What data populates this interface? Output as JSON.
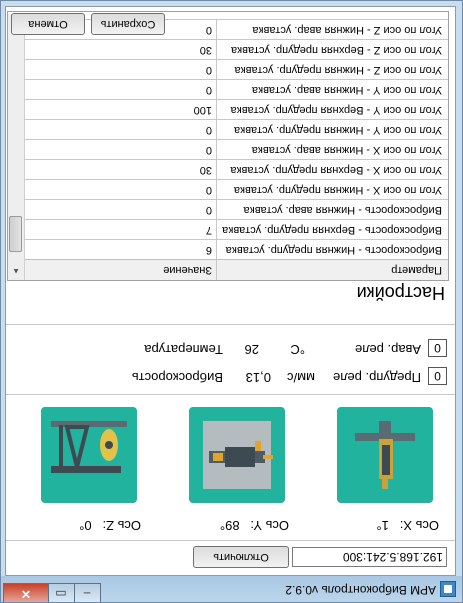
{
  "window": {
    "title": "АРМ Виброконтроль v0.9.2",
    "close": "✕",
    "maximize": "▭",
    "minimize": "–"
  },
  "connection": {
    "ip": "192.168.5.241:300",
    "disconnect_label": "Отключить"
  },
  "axes": [
    {
      "label": "Ось X:",
      "value": "1°"
    },
    {
      "label": "Ось Y:",
      "value": "89°"
    },
    {
      "label": "Ось Z:",
      "value": "0°"
    }
  ],
  "measurements": {
    "vibration": {
      "label": "Виброскорость",
      "value": "0,13",
      "unit": "мм/с"
    },
    "temperature": {
      "label": "Температура",
      "value": "26",
      "unit": "°С"
    }
  },
  "relays": {
    "warning": {
      "label": "Предупр. реле",
      "value": "0"
    },
    "alarm": {
      "label": "Авар. реле",
      "value": "0"
    }
  },
  "settings": {
    "heading": "Настройки",
    "columns": {
      "param": "Параметр",
      "value": "Значение"
    },
    "rows": [
      {
        "param": "Виброскорость - Нижняя предупр. уставка",
        "value": "6"
      },
      {
        "param": "Виброскорость - Верхняя предупр. уставка",
        "value": "7"
      },
      {
        "param": "Виброскорость - Нижняя авар. уставка",
        "value": "0"
      },
      {
        "param": "Угол по оси X - Нижняя предупр. уставка",
        "value": "0"
      },
      {
        "param": "Угол по оси X - Верхняя предупр. уставка",
        "value": "30"
      },
      {
        "param": "Угол по оси X - Нижняя авар. уставка",
        "value": "0"
      },
      {
        "param": "Угол по оси Y - Нижняя предупр. уставка",
        "value": "0"
      },
      {
        "param": "Угол по оси Y - Верхняя предупр. уставка",
        "value": "100"
      },
      {
        "param": "Угол по оси Y - Нижняя авар. уставка",
        "value": "0"
      },
      {
        "param": "Угол по оси Z - Нижняя предупр. уставка",
        "value": "0"
      },
      {
        "param": "Угол по оси Z - Верхняя предупр. уставка",
        "value": "30"
      },
      {
        "param": "Угол по оси Z - Нижняя авар. уставка",
        "value": "0"
      }
    ],
    "save_label": "Сохранить",
    "cancel_label": "Отмена"
  },
  "colors": {
    "tile": "#21b39e",
    "close": "#c8402c"
  }
}
